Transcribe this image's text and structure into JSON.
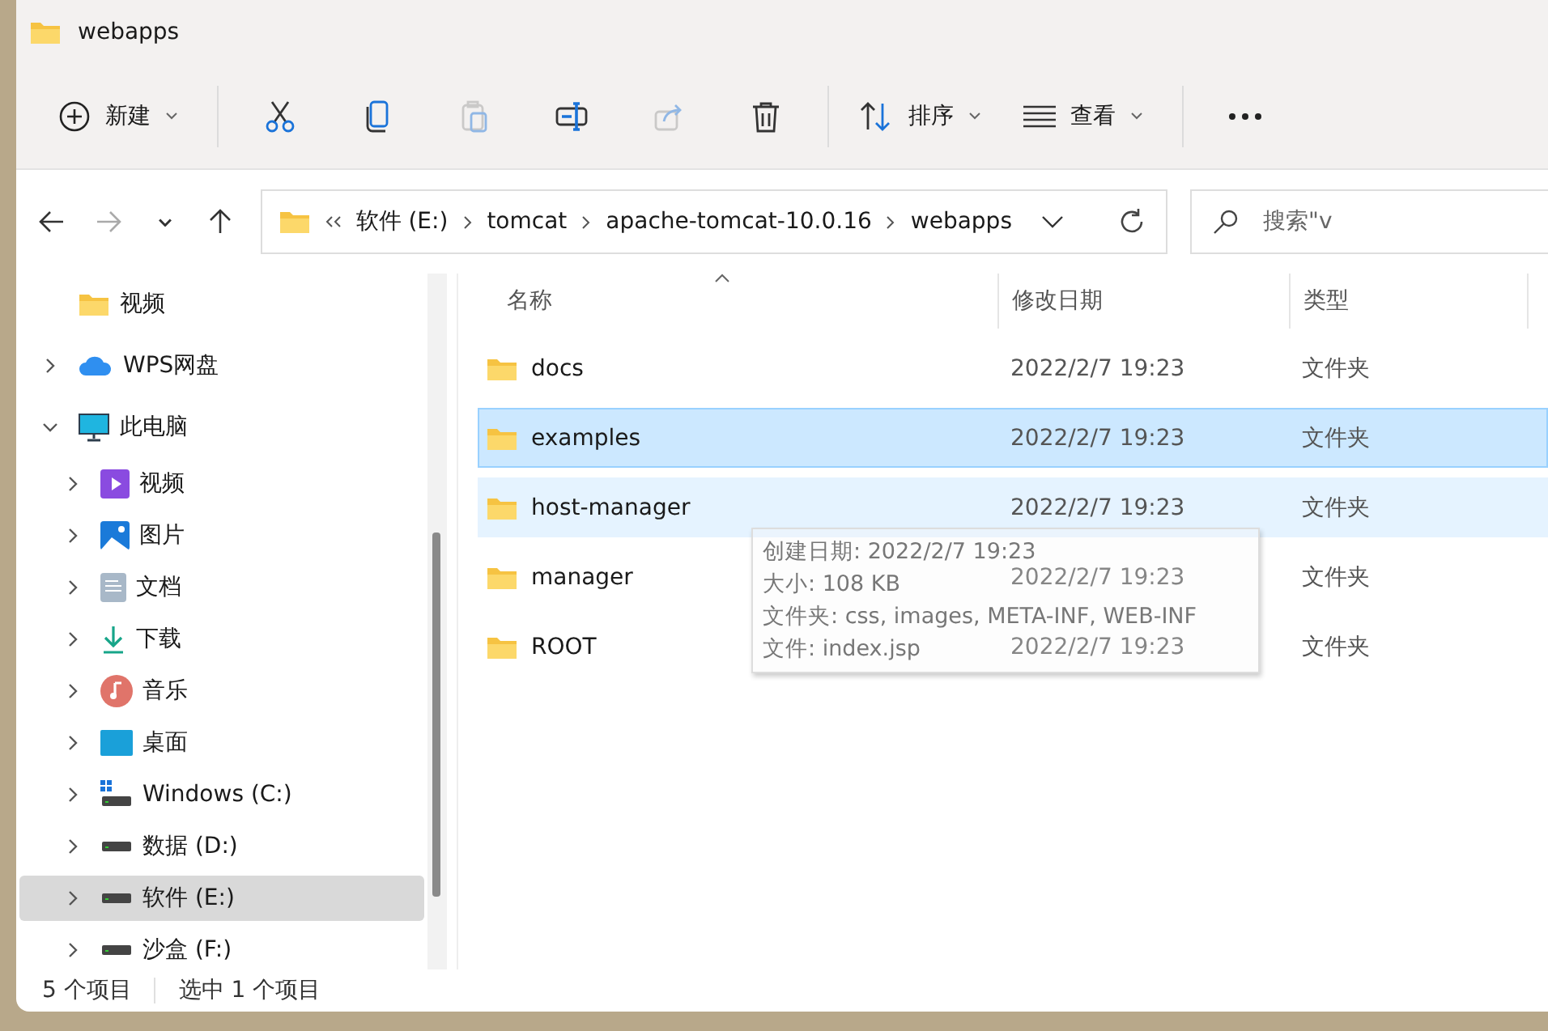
{
  "window": {
    "title": "webapps"
  },
  "toolbar": {
    "new_button": {
      "label": "新建"
    },
    "actions": [
      {
        "disabled": false
      },
      {
        "disabled": false
      },
      {
        "disabled": true
      },
      {
        "disabled": false
      },
      {
        "disabled": true
      },
      {
        "disabled": false
      }
    ],
    "sort_button": {
      "label": "排序"
    },
    "view_button": {
      "label": "查看"
    }
  },
  "navigation": [
    {
      "disabled": false
    },
    {
      "disabled": true
    },
    {
      "disabled": false
    },
    {
      "disabled": false
    }
  ],
  "address_bar": {
    "breadcrumbs": [
      "软件 (E:)",
      "tomcat",
      "apache-tomcat-10.0.16",
      "webapps"
    ]
  },
  "search": {
    "placeholder": "搜索\"v"
  },
  "sidebar": {
    "items": [
      {
        "label": "视频",
        "kind": "pinned-folder",
        "selected": false
      },
      {
        "label": "WPS网盘",
        "kind": "cloud",
        "expanded": false,
        "selected": false
      },
      {
        "label": "此电脑",
        "kind": "computer",
        "expanded": true,
        "selected": false,
        "children": [
          {
            "label": "视频",
            "kind": "videos",
            "expanded": false,
            "selected": false
          },
          {
            "label": "图片",
            "kind": "pictures",
            "expanded": false,
            "selected": false
          },
          {
            "label": "文档",
            "kind": "documents",
            "expanded": false,
            "selected": false
          },
          {
            "label": "下载",
            "kind": "downloads",
            "expanded": false,
            "selected": false
          },
          {
            "label": "音乐",
            "kind": "music",
            "expanded": false,
            "selected": false
          },
          {
            "label": "桌面",
            "kind": "desktop",
            "expanded": false,
            "selected": false
          },
          {
            "label": "Windows (C:)",
            "kind": "system-drive",
            "expanded": false,
            "selected": false
          },
          {
            "label": "数据 (D:)",
            "kind": "drive",
            "expanded": false,
            "selected": false
          },
          {
            "label": "软件 (E:)",
            "kind": "drive",
            "expanded": false,
            "selected": true
          },
          {
            "label": "沙盒 (F:)",
            "kind": "drive",
            "expanded": false,
            "selected": false
          }
        ]
      }
    ]
  },
  "table": {
    "columns": [
      {
        "label": "名称",
        "sorted": true
      },
      {
        "label": "修改日期",
        "sorted": false
      },
      {
        "label": "类型",
        "sorted": false
      }
    ],
    "rows": [
      {
        "name": "docs",
        "modified": "2022/2/7 19:23",
        "type": "文件夹",
        "selected": false,
        "hovered": false
      },
      {
        "name": "examples",
        "modified": "2022/2/7 19:23",
        "type": "文件夹",
        "selected": true,
        "hovered": false
      },
      {
        "name": "host-manager",
        "modified": "2022/2/7 19:23",
        "type": "文件夹",
        "selected": false,
        "hovered": true
      },
      {
        "name": "manager",
        "modified": "2022/2/7 19:23",
        "type": "文件夹",
        "selected": false,
        "hovered": false
      },
      {
        "name": "ROOT",
        "modified": "2022/2/7 19:23",
        "type": "文件夹",
        "selected": false,
        "hovered": false
      }
    ]
  },
  "tooltip": {
    "lines": [
      "创建日期: 2022/2/7 19:23",
      "大小: 108 KB",
      "文件夹: css, images, META-INF, WEB-INF",
      "文件: index.jsp"
    ]
  },
  "status_bar": {
    "item_count": "5 个项目",
    "selection": "选中 1 个项目"
  }
}
